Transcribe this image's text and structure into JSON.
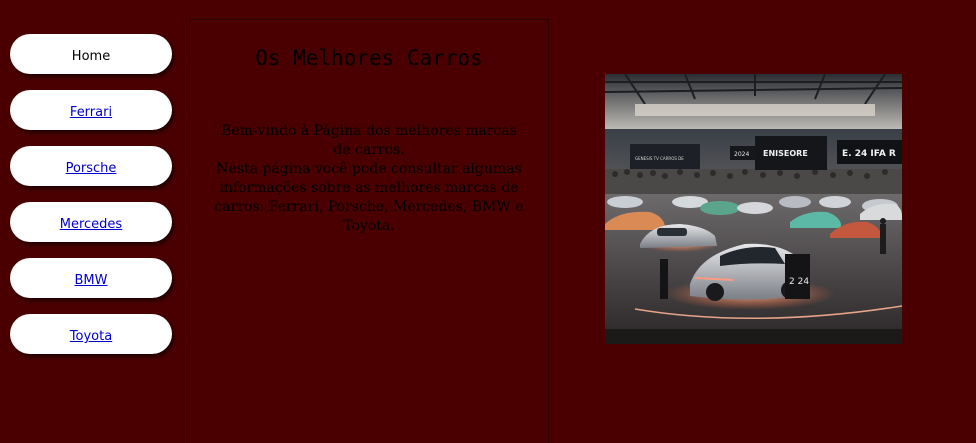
{
  "nav": {
    "items": [
      {
        "label": "Home"
      },
      {
        "label": "Ferrari"
      },
      {
        "label": "Porsche"
      },
      {
        "label": "Mercedes"
      },
      {
        "label": "BMW"
      },
      {
        "label": "Toyota"
      }
    ]
  },
  "main": {
    "title": "Os Melhores Carros",
    "intro_line1": "Bem-vindo à Página dos melhores marcas de carros.",
    "intro_line2": "Nesta página você pode consultar algumas informações sobre as melhores marcas de carros: Ferrari, Porsche, Mercedes, BMW e Toyota."
  },
  "image": {
    "sign_left": "ENISEORE",
    "sign_right": "E. 24 IFA R",
    "sign_small": "2024",
    "screen_text": "GENESIS TV CARROS DE",
    "stand_label": "2 24"
  },
  "colors": {
    "background": "#4a0000",
    "button": "#ffffff",
    "link": "#0000cc"
  }
}
